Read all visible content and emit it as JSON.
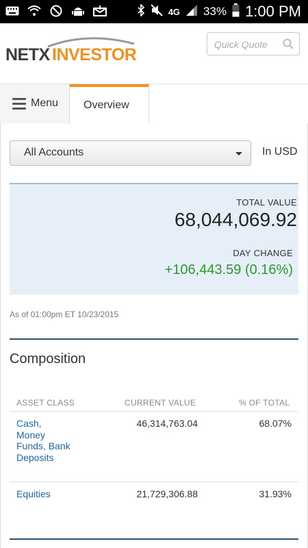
{
  "status_bar": {
    "battery": "33%",
    "time": "1:00 PM",
    "network": "4G"
  },
  "header": {
    "logo_left": "NETX",
    "logo_right": "INVESTOR",
    "quote_placeholder": "Quick Quote"
  },
  "tabs": {
    "menu_label": "Menu",
    "overview_label": "Overview"
  },
  "account": {
    "selected": "All Accounts",
    "currency": "In USD"
  },
  "summary": {
    "total_value_label": "TOTAL VALUE",
    "total_value": "68,044,069.92",
    "day_change_label": "DAY CHANGE",
    "day_change": "+106,443.59 (0.16%)"
  },
  "as_of": "As of 01:00pm ET 10/23/2015",
  "composition": {
    "title": "Composition",
    "headers": [
      "ASSET CLASS",
      "CURRENT VALUE",
      "% OF TOTAL"
    ],
    "rows": [
      {
        "asset_class": "Cash, Money Funds, Bank Deposits",
        "current_value": "46,314,763.04",
        "pct": "68.07%"
      },
      {
        "asset_class": "Equities",
        "current_value": "21,729,306.88",
        "pct": "31.93%"
      }
    ]
  },
  "colors": {
    "accent_orange": "#f0901e",
    "gain_green": "#2a9a2a",
    "link_blue": "#1b68a8",
    "rule_navy": "#2a4f73",
    "summary_bg": "#e6eef7"
  }
}
